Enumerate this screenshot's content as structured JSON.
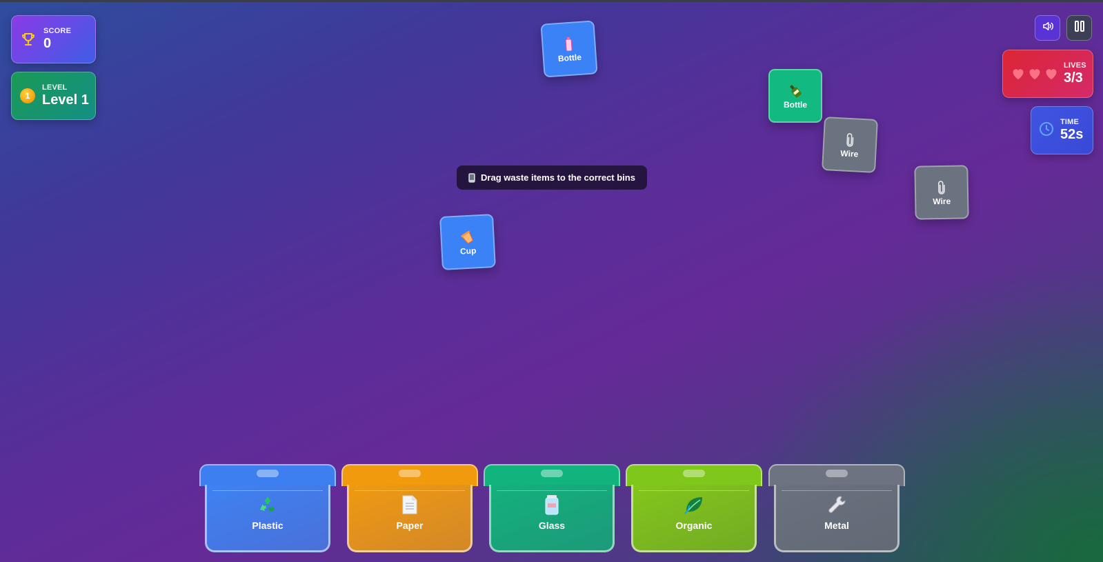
{
  "hud": {
    "score": {
      "label": "SCORE",
      "value": "0",
      "icon": "trophy-icon"
    },
    "level": {
      "label": "LEVEL",
      "value": "Level 1",
      "badge": "1"
    },
    "lives": {
      "label": "LIVES",
      "value": "3/3",
      "hearts_remaining": 3,
      "hearts_total": 3
    },
    "time": {
      "label": "TIME",
      "value": "52s",
      "icon": "clock-icon"
    }
  },
  "controls": {
    "sound": {
      "icon": "speaker-icon"
    },
    "pause": {
      "icon": "pause-icon"
    }
  },
  "hint": {
    "text": "Drag waste items to the correct bins",
    "icon": "phone-icon"
  },
  "items": [
    {
      "label": "Bottle",
      "icon": "plastic-bottle-icon",
      "color": "#3b82f6"
    },
    {
      "label": "Bottle",
      "icon": "glass-bottle-icon",
      "color": "#12b981"
    },
    {
      "label": "Wire",
      "icon": "paperclip-icon",
      "color": "#6b7280"
    },
    {
      "label": "Wire",
      "icon": "paperclip-icon",
      "color": "#6b7280"
    },
    {
      "label": "Cup",
      "icon": "cup-icon",
      "color": "#3b82f6"
    }
  ],
  "bins": [
    {
      "label": "Plastic",
      "icon": "recycle-icon",
      "color": "#3d7ff0"
    },
    {
      "label": "Paper",
      "icon": "document-icon",
      "color": "#f29a0e"
    },
    {
      "label": "Glass",
      "icon": "jar-icon",
      "color": "#12b47e"
    },
    {
      "label": "Organic",
      "icon": "leaf-icon",
      "color": "#7fc71a"
    },
    {
      "label": "Metal",
      "icon": "wrench-icon",
      "color": "#6d7380"
    }
  ]
}
